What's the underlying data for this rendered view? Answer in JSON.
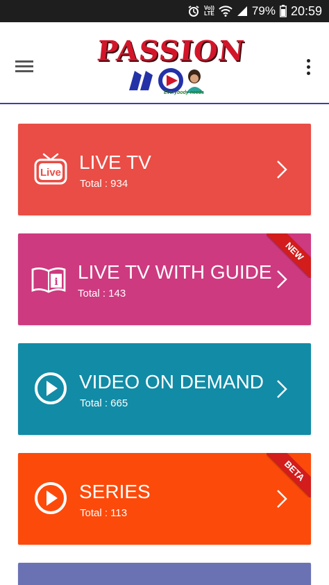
{
  "status_bar": {
    "volte_line1": "Vo))",
    "volte_line2": "LTE",
    "battery_percent": "79%",
    "time": "20:59",
    "icons": [
      "alarm-icon",
      "volte-icon",
      "wifi-icon",
      "signal-icon",
      "battery-icon"
    ]
  },
  "header": {
    "logo_text": "PASSION",
    "logo_tagline": "Everybody needs",
    "border_color": "#3b3fa8"
  },
  "cards": [
    {
      "title": "LIVE TV",
      "subtitle": "Total : 934",
      "color": "#e94d45",
      "icon": "live-tv-icon",
      "badge": ""
    },
    {
      "title": "LIVE TV WITH GUIDE",
      "subtitle": "Total : 143",
      "color": "#cd3a7f",
      "icon": "book-guide-icon",
      "badge": "NEW",
      "badge_color": "#d31c1c"
    },
    {
      "title": "VIDEO ON DEMAND",
      "subtitle": "Total : 665",
      "color": "#128ba6",
      "icon": "play-circle-icon",
      "badge": ""
    },
    {
      "title": "SERIES",
      "subtitle": "Total : 113",
      "color": "#fc4a0b",
      "icon": "play-circle-icon",
      "badge": "BETA",
      "badge_color": "#d31c1c"
    },
    {
      "title": "",
      "subtitle": "",
      "color": "#6b72b4",
      "icon": "",
      "badge": ""
    }
  ]
}
